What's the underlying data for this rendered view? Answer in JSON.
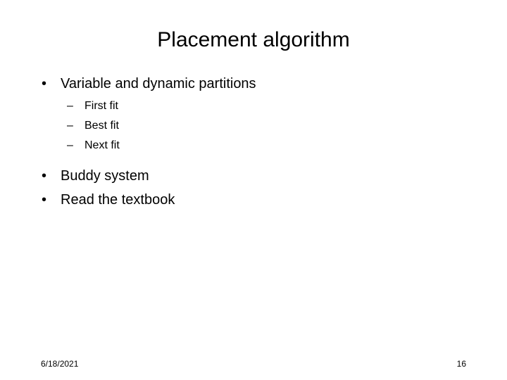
{
  "slide": {
    "title": "Placement algorithm",
    "background_color": "#ffffff",
    "text_color": "#000000",
    "bullets": [
      {
        "marker": "•",
        "label": "Variable and dynamic partitions",
        "children": [
          {
            "marker": "–",
            "label": "First fit"
          },
          {
            "marker": "–",
            "label": "Best fit"
          },
          {
            "marker": "–",
            "label": "Next fit"
          }
        ]
      },
      {
        "marker": "•",
        "label": "Buddy system",
        "children": []
      },
      {
        "marker": "•",
        "label": "Read the textbook",
        "children": []
      }
    ],
    "footer": {
      "date": "6/18/2021",
      "page_number": "16"
    }
  }
}
